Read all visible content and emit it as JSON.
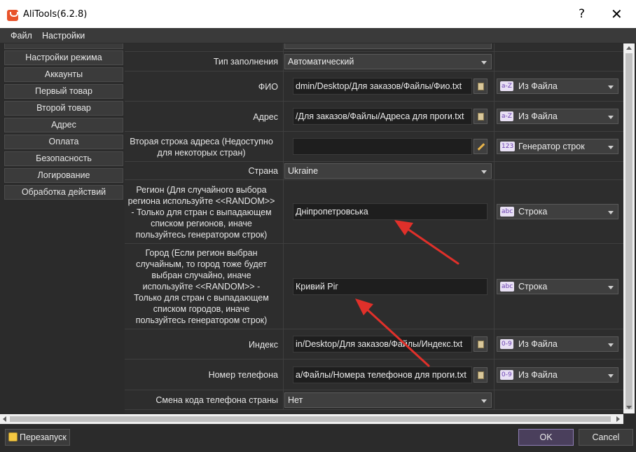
{
  "window": {
    "title": "AliTools(6.2.8)",
    "help_glyph": "?",
    "close_glyph": "✕"
  },
  "menu": {
    "file": "Файл",
    "settings": "Настройки"
  },
  "sidebar": {
    "items": [
      {
        "label": "Настройки режима"
      },
      {
        "label": "Аккаунты"
      },
      {
        "label": "Первый товар"
      },
      {
        "label": "Второй товар"
      },
      {
        "label": "Адрес"
      },
      {
        "label": "Оплата"
      },
      {
        "label": "Безопасность"
      },
      {
        "label": "Логирование"
      },
      {
        "label": "Обработка действий"
      }
    ]
  },
  "form": {
    "fill_type": {
      "label": "Тип заполнения",
      "value": "Автоматический"
    },
    "fio": {
      "label": "ФИО",
      "path": "dmin/Desktop/Для заказов/Файлы/Фио.txt",
      "source_badge": "a-Z",
      "source": "Из Файла"
    },
    "address": {
      "label": "Адрес",
      "path": "/Для заказов/Файлы/Адреса для проги.txt",
      "source_badge": "a-Z",
      "source": "Из Файла"
    },
    "address2": {
      "label_line1": "Вторая строка адреса (Недоступно",
      "label_line2": "для некоторых стран)",
      "value": "",
      "source_badge": "123",
      "source": "Генератор строк"
    },
    "country": {
      "label": "Страна",
      "value": "Ukraine"
    },
    "region": {
      "label_lines": [
        "Регион (Для случайного выбора",
        "региона используйте <<RANDOM>>",
        "- Только для стран с выпадающем",
        "списком регионов, иначе",
        "пользуйтесь генератором строк)"
      ],
      "value": "Дніпропетровська",
      "source_badge": "abc",
      "source": "Строка"
    },
    "city": {
      "label_lines": [
        "Город (Если регион выбран",
        "случайным, то город тоже будет",
        "выбран случайно, иначе",
        "используйте <<RANDOM>> -",
        "Только для стран с выпадающем",
        "списком городов, иначе",
        "пользуйтесь генератором строк)"
      ],
      "value": "Кривий Ріг",
      "source_badge": "abc",
      "source": "Строка"
    },
    "index": {
      "label": "Индекс",
      "path": "in/Desktop/Для заказов/Файлы/Индекс.txt",
      "source_badge": "0-9",
      "source": "Из Файла"
    },
    "phone": {
      "label": "Номер телефона",
      "path": "а/Файлы/Номера телефонов для проги.txt",
      "source_badge": "0-9",
      "source": "Из Файла"
    },
    "phone_code": {
      "label": "Смена кода телефона страны",
      "value": "Нет"
    }
  },
  "bottom": {
    "restart": "Перезапуск",
    "ok": "OK",
    "cancel": "Cancel"
  },
  "colors": {
    "background": "#2b2b2b",
    "accent_ok_border": "#8f7fb5",
    "arrow_red": "#e0302a",
    "app_icon": "#e8532b"
  }
}
